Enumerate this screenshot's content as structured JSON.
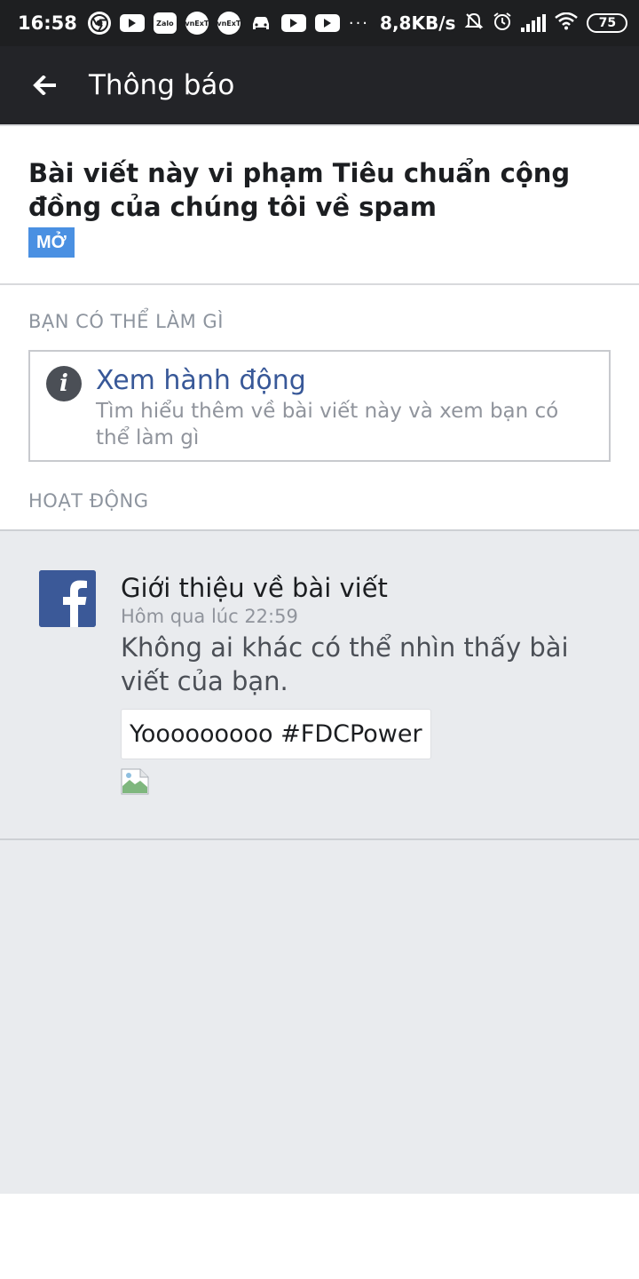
{
  "status_bar": {
    "time": "16:58",
    "zalo_label": "Zalo",
    "vneid_label": "vnExT",
    "network_speed": "8,8KB/s",
    "battery": "75"
  },
  "app_bar": {
    "title": "Thông báo",
    "back_icon": "arrow-left-icon"
  },
  "notice": {
    "headline": "Bài viết này vi phạm Tiêu chuẩn cộng đồng của chúng tôi về spam",
    "status_badge": "MỞ"
  },
  "what_you_can_do": {
    "section_label": "BẠN CÓ THỂ LÀM GÌ",
    "action_title": "Xem hành động",
    "action_description": "Tìm hiểu thêm về bài viết này và xem bạn có thể làm gì"
  },
  "activity": {
    "section_label": "HOẠT ĐỘNG",
    "items": [
      {
        "title": "Giới thiệu về bài viết",
        "timestamp": "Hôm qua lúc 22:59",
        "description": "Không ai khác có thể nhìn thấy bài viết của bạn.",
        "post_preview": "Yooooooooo #FDCPower"
      }
    ]
  },
  "colors": {
    "app_bar": "#232428",
    "badge": "#4a90e2",
    "link": "#385898",
    "activity_bg": "#e9ebee",
    "facebook_blue": "#3b5998"
  }
}
